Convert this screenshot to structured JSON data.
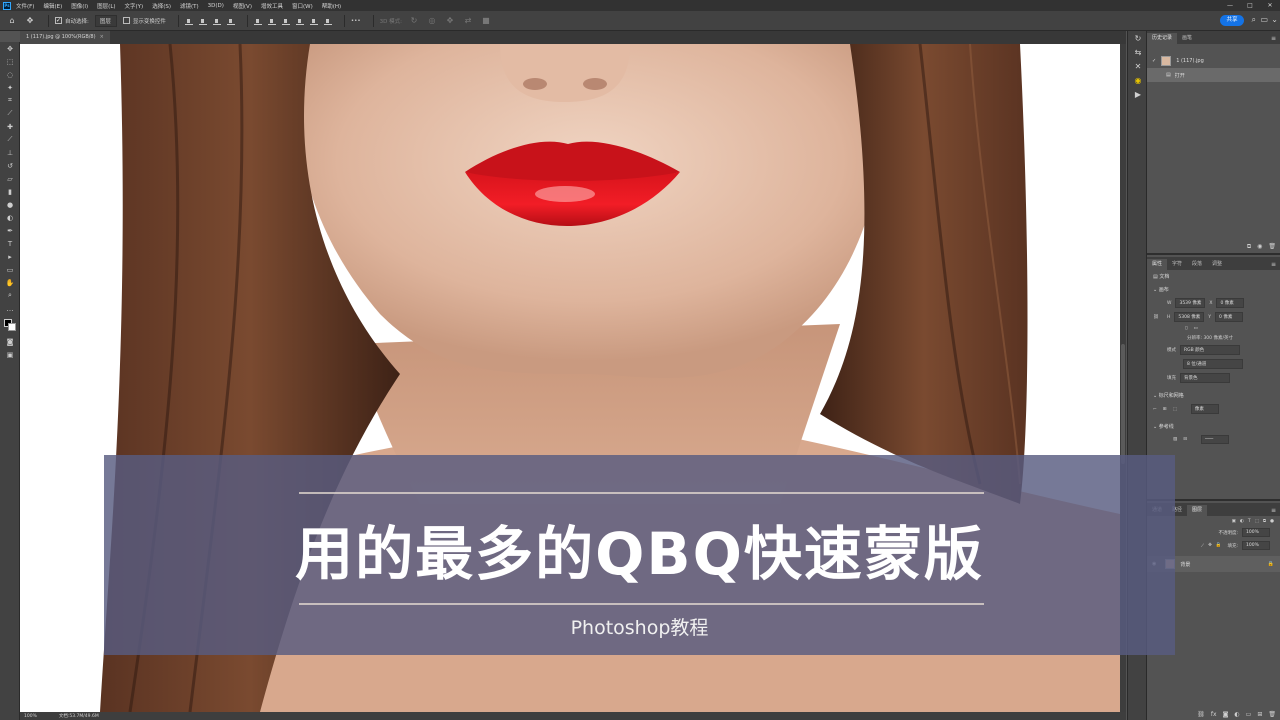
{
  "app": {
    "logo_text": "Ps"
  },
  "menu": {
    "items": [
      "文件(F)",
      "编辑(E)",
      "图像(I)",
      "图层(L)",
      "文字(Y)",
      "选择(S)",
      "滤镜(T)",
      "3D(D)",
      "视图(V)",
      "增效工具",
      "窗口(W)",
      "帮助(H)"
    ],
    "window_controls": [
      "—",
      "□",
      "✕"
    ]
  },
  "options_bar": {
    "auto_select_label": "自动选择:",
    "auto_select_target": "图层",
    "show_transform_label": "显示变换控件",
    "more_label": "•••",
    "mode_3d_label": "3D 模式:",
    "share_label": "共享"
  },
  "document": {
    "tab_title": "1 (117).jpg @ 100%(RGB/8)",
    "close_glyph": "×",
    "zoom": "100%",
    "doc_size": "文档:53.7M/49.6M"
  },
  "panels": {
    "history": {
      "tabs": [
        "历史记录",
        "画笔"
      ],
      "snapshot_name": "1 (117).jpg",
      "steps": [
        "打开"
      ]
    },
    "properties": {
      "tabs": [
        "属性",
        "字符",
        "段落",
        "调整"
      ],
      "doc_label": "文档",
      "canvas_section": "画布",
      "w_label": "W",
      "w_value": "3539 像素",
      "h_label": "H",
      "h_value": "5308 像素",
      "x_label": "X",
      "x_value": "0 像素",
      "y_label": "Y",
      "y_value": "0 像素",
      "resolution": "分辨率: 300 像素/英寸",
      "mode_label": "模式",
      "mode_value": "RGB 颜色",
      "depth_value": "8 位/通道",
      "fill_label": "填充",
      "fill_value": "背景色",
      "rulers_section": "标尺和网格",
      "ruler_unit": "像素",
      "guides_section": "参考线"
    },
    "layers": {
      "tabs": [
        "通道",
        "路径",
        "图层"
      ],
      "opacity_label": "不透明度:",
      "opacity_value": "100%",
      "fill_label": "填充:",
      "fill_value": "100%",
      "layer_name": "背景"
    }
  },
  "banner": {
    "title": "用的最多的QBQ快速蒙版",
    "subtitle": "Photoshop教程"
  },
  "colors": {
    "accent_blue": "#1473e6",
    "banner_bg": "#585c80",
    "highlight_yellow": "#e8c400"
  }
}
